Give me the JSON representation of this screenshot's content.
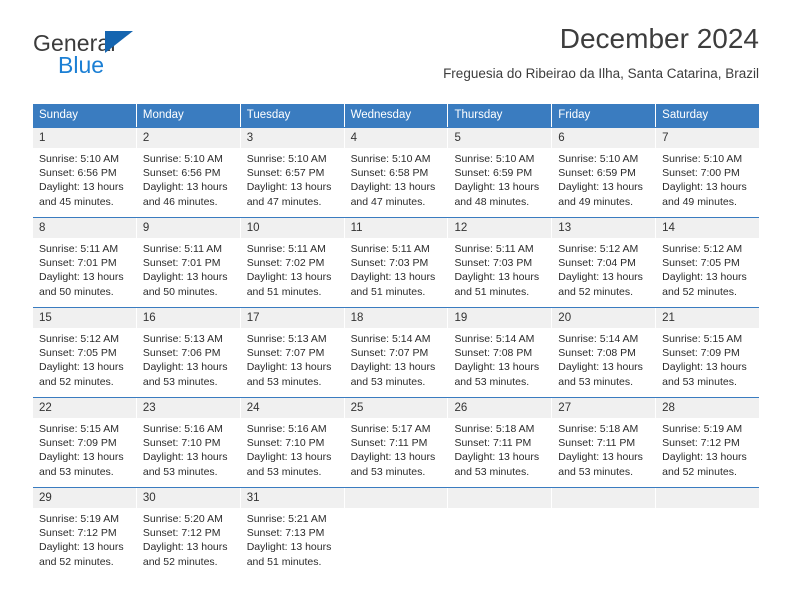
{
  "logo": {
    "primary_text": "General",
    "secondary_text": "Blue",
    "primary_color": "#3b3b3b",
    "secondary_color": "#1b7fd4",
    "triangle_color": "#1565b0"
  },
  "header": {
    "title": "December 2024",
    "subtitle": "Freguesia do Ribeirao da Ilha, Santa Catarina, Brazil"
  },
  "theme": {
    "header_row_background": "#3a7cc0",
    "header_row_text": "#ffffff",
    "daynum_background": "#f0f0f0",
    "row_divider": "#3a7cc0"
  },
  "weekdays": [
    "Sunday",
    "Monday",
    "Tuesday",
    "Wednesday",
    "Thursday",
    "Friday",
    "Saturday"
  ],
  "weeks": [
    [
      {
        "day": "1",
        "sunrise": "Sunrise: 5:10 AM",
        "sunset": "Sunset: 6:56 PM",
        "daylight_line1": "Daylight: 13 hours",
        "daylight_line2": "and 45 minutes."
      },
      {
        "day": "2",
        "sunrise": "Sunrise: 5:10 AM",
        "sunset": "Sunset: 6:56 PM",
        "daylight_line1": "Daylight: 13 hours",
        "daylight_line2": "and 46 minutes."
      },
      {
        "day": "3",
        "sunrise": "Sunrise: 5:10 AM",
        "sunset": "Sunset: 6:57 PM",
        "daylight_line1": "Daylight: 13 hours",
        "daylight_line2": "and 47 minutes."
      },
      {
        "day": "4",
        "sunrise": "Sunrise: 5:10 AM",
        "sunset": "Sunset: 6:58 PM",
        "daylight_line1": "Daylight: 13 hours",
        "daylight_line2": "and 47 minutes."
      },
      {
        "day": "5",
        "sunrise": "Sunrise: 5:10 AM",
        "sunset": "Sunset: 6:59 PM",
        "daylight_line1": "Daylight: 13 hours",
        "daylight_line2": "and 48 minutes."
      },
      {
        "day": "6",
        "sunrise": "Sunrise: 5:10 AM",
        "sunset": "Sunset: 6:59 PM",
        "daylight_line1": "Daylight: 13 hours",
        "daylight_line2": "and 49 minutes."
      },
      {
        "day": "7",
        "sunrise": "Sunrise: 5:10 AM",
        "sunset": "Sunset: 7:00 PM",
        "daylight_line1": "Daylight: 13 hours",
        "daylight_line2": "and 49 minutes."
      }
    ],
    [
      {
        "day": "8",
        "sunrise": "Sunrise: 5:11 AM",
        "sunset": "Sunset: 7:01 PM",
        "daylight_line1": "Daylight: 13 hours",
        "daylight_line2": "and 50 minutes."
      },
      {
        "day": "9",
        "sunrise": "Sunrise: 5:11 AM",
        "sunset": "Sunset: 7:01 PM",
        "daylight_line1": "Daylight: 13 hours",
        "daylight_line2": "and 50 minutes."
      },
      {
        "day": "10",
        "sunrise": "Sunrise: 5:11 AM",
        "sunset": "Sunset: 7:02 PM",
        "daylight_line1": "Daylight: 13 hours",
        "daylight_line2": "and 51 minutes."
      },
      {
        "day": "11",
        "sunrise": "Sunrise: 5:11 AM",
        "sunset": "Sunset: 7:03 PM",
        "daylight_line1": "Daylight: 13 hours",
        "daylight_line2": "and 51 minutes."
      },
      {
        "day": "12",
        "sunrise": "Sunrise: 5:11 AM",
        "sunset": "Sunset: 7:03 PM",
        "daylight_line1": "Daylight: 13 hours",
        "daylight_line2": "and 51 minutes."
      },
      {
        "day": "13",
        "sunrise": "Sunrise: 5:12 AM",
        "sunset": "Sunset: 7:04 PM",
        "daylight_line1": "Daylight: 13 hours",
        "daylight_line2": "and 52 minutes."
      },
      {
        "day": "14",
        "sunrise": "Sunrise: 5:12 AM",
        "sunset": "Sunset: 7:05 PM",
        "daylight_line1": "Daylight: 13 hours",
        "daylight_line2": "and 52 minutes."
      }
    ],
    [
      {
        "day": "15",
        "sunrise": "Sunrise: 5:12 AM",
        "sunset": "Sunset: 7:05 PM",
        "daylight_line1": "Daylight: 13 hours",
        "daylight_line2": "and 52 minutes."
      },
      {
        "day": "16",
        "sunrise": "Sunrise: 5:13 AM",
        "sunset": "Sunset: 7:06 PM",
        "daylight_line1": "Daylight: 13 hours",
        "daylight_line2": "and 53 minutes."
      },
      {
        "day": "17",
        "sunrise": "Sunrise: 5:13 AM",
        "sunset": "Sunset: 7:07 PM",
        "daylight_line1": "Daylight: 13 hours",
        "daylight_line2": "and 53 minutes."
      },
      {
        "day": "18",
        "sunrise": "Sunrise: 5:14 AM",
        "sunset": "Sunset: 7:07 PM",
        "daylight_line1": "Daylight: 13 hours",
        "daylight_line2": "and 53 minutes."
      },
      {
        "day": "19",
        "sunrise": "Sunrise: 5:14 AM",
        "sunset": "Sunset: 7:08 PM",
        "daylight_line1": "Daylight: 13 hours",
        "daylight_line2": "and 53 minutes."
      },
      {
        "day": "20",
        "sunrise": "Sunrise: 5:14 AM",
        "sunset": "Sunset: 7:08 PM",
        "daylight_line1": "Daylight: 13 hours",
        "daylight_line2": "and 53 minutes."
      },
      {
        "day": "21",
        "sunrise": "Sunrise: 5:15 AM",
        "sunset": "Sunset: 7:09 PM",
        "daylight_line1": "Daylight: 13 hours",
        "daylight_line2": "and 53 minutes."
      }
    ],
    [
      {
        "day": "22",
        "sunrise": "Sunrise: 5:15 AM",
        "sunset": "Sunset: 7:09 PM",
        "daylight_line1": "Daylight: 13 hours",
        "daylight_line2": "and 53 minutes."
      },
      {
        "day": "23",
        "sunrise": "Sunrise: 5:16 AM",
        "sunset": "Sunset: 7:10 PM",
        "daylight_line1": "Daylight: 13 hours",
        "daylight_line2": "and 53 minutes."
      },
      {
        "day": "24",
        "sunrise": "Sunrise: 5:16 AM",
        "sunset": "Sunset: 7:10 PM",
        "daylight_line1": "Daylight: 13 hours",
        "daylight_line2": "and 53 minutes."
      },
      {
        "day": "25",
        "sunrise": "Sunrise: 5:17 AM",
        "sunset": "Sunset: 7:11 PM",
        "daylight_line1": "Daylight: 13 hours",
        "daylight_line2": "and 53 minutes."
      },
      {
        "day": "26",
        "sunrise": "Sunrise: 5:18 AM",
        "sunset": "Sunset: 7:11 PM",
        "daylight_line1": "Daylight: 13 hours",
        "daylight_line2": "and 53 minutes."
      },
      {
        "day": "27",
        "sunrise": "Sunrise: 5:18 AM",
        "sunset": "Sunset: 7:11 PM",
        "daylight_line1": "Daylight: 13 hours",
        "daylight_line2": "and 53 minutes."
      },
      {
        "day": "28",
        "sunrise": "Sunrise: 5:19 AM",
        "sunset": "Sunset: 7:12 PM",
        "daylight_line1": "Daylight: 13 hours",
        "daylight_line2": "and 52 minutes."
      }
    ],
    [
      {
        "day": "29",
        "sunrise": "Sunrise: 5:19 AM",
        "sunset": "Sunset: 7:12 PM",
        "daylight_line1": "Daylight: 13 hours",
        "daylight_line2": "and 52 minutes."
      },
      {
        "day": "30",
        "sunrise": "Sunrise: 5:20 AM",
        "sunset": "Sunset: 7:12 PM",
        "daylight_line1": "Daylight: 13 hours",
        "daylight_line2": "and 52 minutes."
      },
      {
        "day": "31",
        "sunrise": "Sunrise: 5:21 AM",
        "sunset": "Sunset: 7:13 PM",
        "daylight_line1": "Daylight: 13 hours",
        "daylight_line2": "and 51 minutes."
      },
      {
        "day": "",
        "sunrise": "",
        "sunset": "",
        "daylight_line1": "",
        "daylight_line2": ""
      },
      {
        "day": "",
        "sunrise": "",
        "sunset": "",
        "daylight_line1": "",
        "daylight_line2": ""
      },
      {
        "day": "",
        "sunrise": "",
        "sunset": "",
        "daylight_line1": "",
        "daylight_line2": ""
      },
      {
        "day": "",
        "sunrise": "",
        "sunset": "",
        "daylight_line1": "",
        "daylight_line2": ""
      }
    ]
  ]
}
